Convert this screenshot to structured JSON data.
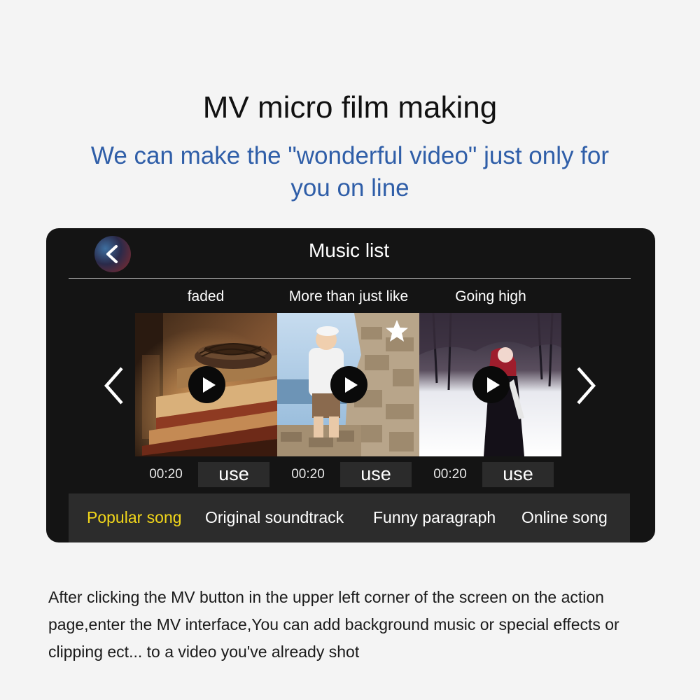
{
  "header": {
    "title": "MV micro film making",
    "subtitle": "We can make the \"wonderful video\" just only for you on line"
  },
  "screen": {
    "title": "Music list",
    "icons": {
      "back": "chevron-left-icon",
      "prev": "chevron-left-icon",
      "next": "chevron-right-icon",
      "play": "play-icon",
      "favorite": "star-icon"
    },
    "songs": [
      {
        "title": "faded",
        "duration": "00:20",
        "action": "use"
      },
      {
        "title": "More than just like",
        "duration": "00:20",
        "action": "use",
        "favorited": true
      },
      {
        "title": "Going high",
        "duration": "00:20",
        "action": "use"
      }
    ],
    "tabs": [
      {
        "label": "Popular song",
        "active": true
      },
      {
        "label": "Original soundtrack",
        "active": false
      },
      {
        "label": "Funny paragraph",
        "active": false
      },
      {
        "label": "Online song",
        "active": false
      }
    ],
    "colors": {
      "active_tab": "#f1d61a",
      "subtitle": "#2f5ea8"
    }
  },
  "description": "After clicking the MV button in the upper left corner of the screen on the action page,enter the MV interface,You can add background music or special effects or clipping ect... to a video you've already shot"
}
